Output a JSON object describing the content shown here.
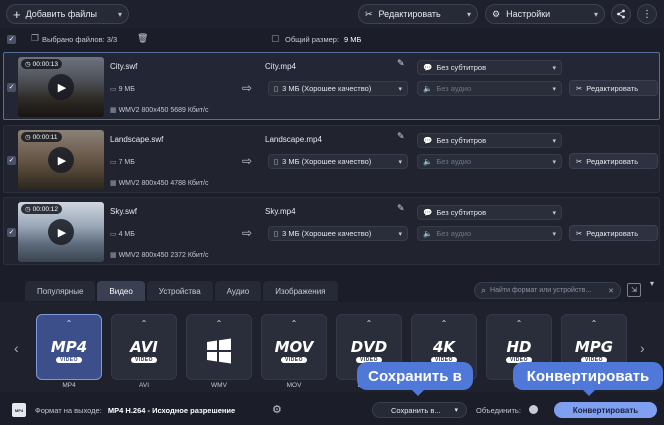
{
  "toolbar": {
    "add_files": "Добавить файлы",
    "edit": "Редактировать",
    "settings": "Настройки"
  },
  "infobar": {
    "selected": "Выбрано файлов: 3/3",
    "total_size_label": "Общий размер:",
    "total_size_value": "9 МБ"
  },
  "files": [
    {
      "duration": "00:00:13",
      "name": "City.swf",
      "size": "9 МБ",
      "specs": "WMV2 800x450 5689 Кбит/с",
      "output_name": "City.mp4",
      "quality": "3 МБ (Хорошее качество)",
      "subtitles": "Без субтитров",
      "audio": "Без аудио",
      "edit": "Редактировать"
    },
    {
      "duration": "00:00:11",
      "name": "Landscape.swf",
      "size": "7 МБ",
      "specs": "WMV2 800x450 4788 Кбит/с",
      "output_name": "Landscape.mp4",
      "quality": "3 МБ (Хорошее качество)",
      "subtitles": "Без субтитров",
      "audio": "Без аудио",
      "edit": "Редактировать"
    },
    {
      "duration": "00:00:12",
      "name": "Sky.swf",
      "size": "4 МБ",
      "specs": "WMV2 800x450 2372 Кбит/с",
      "output_name": "Sky.mp4",
      "quality": "3 МБ (Хорошее качество)",
      "subtitles": "Без субтитров",
      "audio": "Без аудио",
      "edit": "Редактировать"
    }
  ],
  "tabs": [
    "Популярные",
    "Видео",
    "Устройства",
    "Аудио",
    "Изображения"
  ],
  "search_placeholder": "Найти формат или устройств...",
  "formats": [
    {
      "big": "MP4",
      "sub": "VIDEO",
      "label": "MP4"
    },
    {
      "big": "AVI",
      "sub": "VIDEO",
      "label": "AVI"
    },
    {
      "big": "",
      "sub": "",
      "label": "WMV"
    },
    {
      "big": "MOV",
      "sub": "VIDEO",
      "label": "MOV"
    },
    {
      "big": "DVD",
      "sub": "VIDEO",
      "label": "DVD-co"
    },
    {
      "big": "4K",
      "sub": "VIDEO",
      "label": ""
    },
    {
      "big": "HD",
      "sub": "VIDEO",
      "label": "HD"
    },
    {
      "big": "MPG",
      "sub": "VIDEO",
      "label": ""
    }
  ],
  "bottom": {
    "output_label": "Формат на выходе:",
    "output_value": "MP4 H.264 - Исходное разрешение",
    "save_to": "Сохранить в...",
    "merge": "Объединить:",
    "convert": "Конвертировать"
  },
  "callouts": {
    "save": "Сохранить в",
    "convert": "Конвертировать"
  },
  "colors": {
    "accent": "#4f78d8",
    "convert_button": "#7fa0f0",
    "active_format": "#3c4f8a"
  }
}
